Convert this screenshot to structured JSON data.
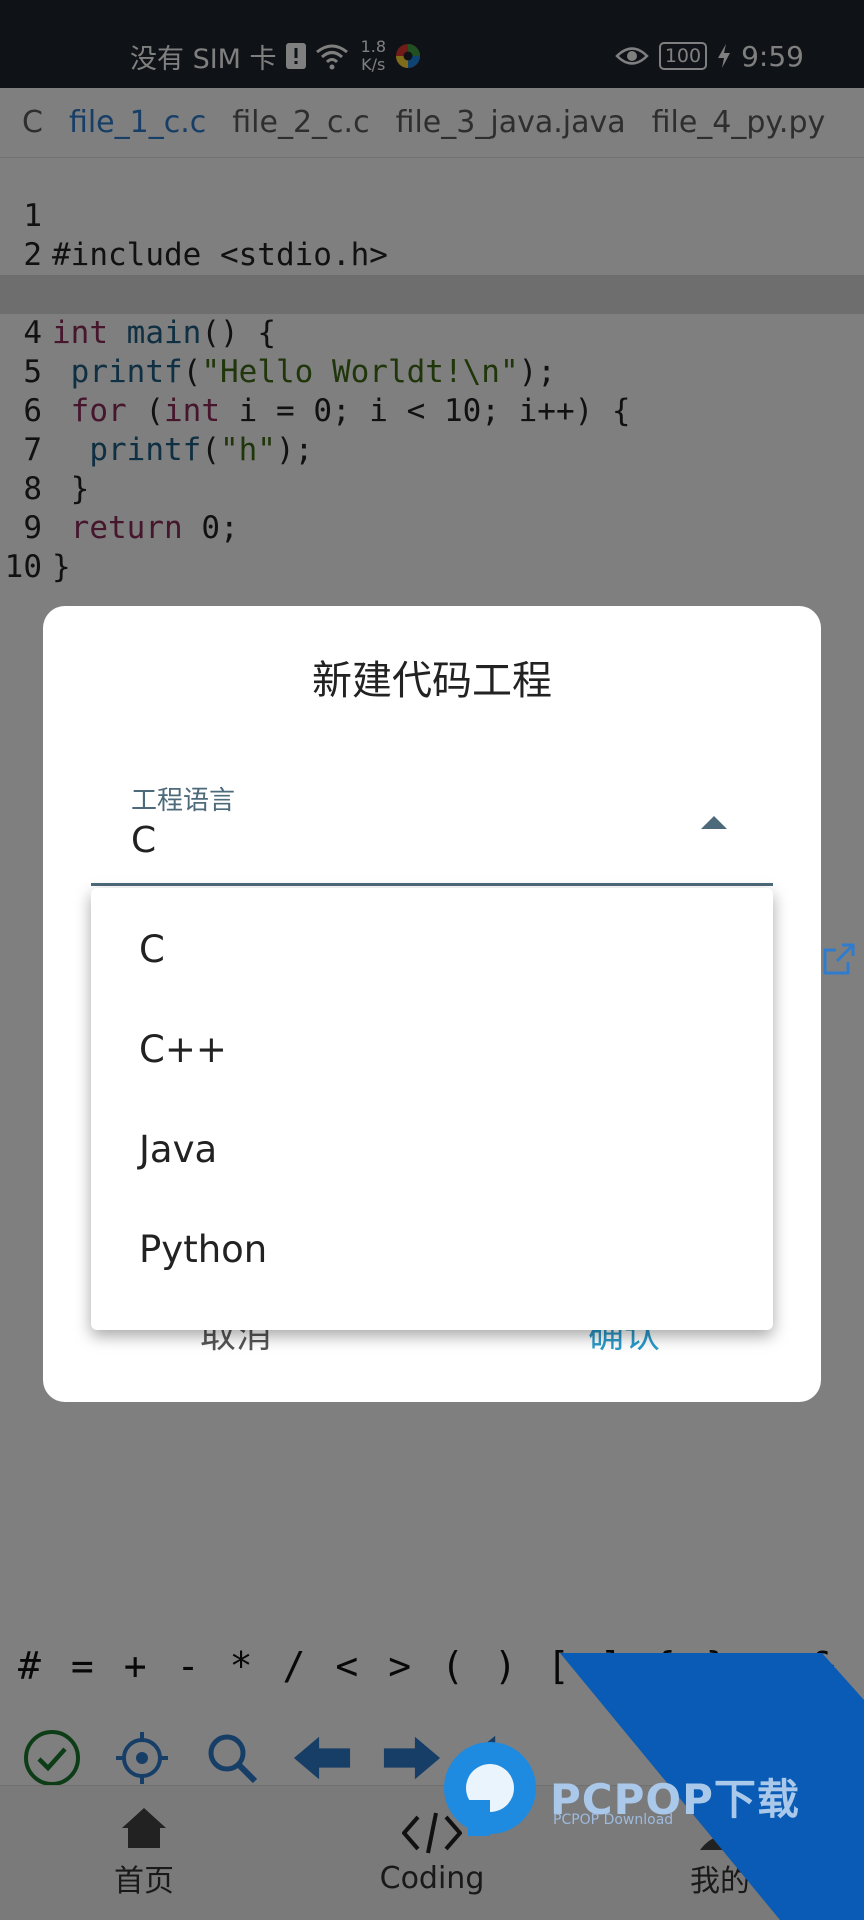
{
  "status_bar": {
    "carrier": "没有 SIM 卡",
    "speed_value": "1.8",
    "speed_unit": "K/s",
    "battery": "100",
    "time": "9:59"
  },
  "tabs": [
    "C",
    "file_1_c.c",
    "file_2_c.c",
    "file_3_java.java",
    "file_4_py.py"
  ],
  "editor": {
    "line_numbers": [
      "1",
      "2",
      "3",
      "4",
      "5",
      "6",
      "7",
      "8",
      "9",
      "10"
    ],
    "code": {
      "l1": "#include <stdio.h>",
      "l3_kw": "int",
      "l3_fn": "main",
      "l3_rest": "() {",
      "l4_fn": "printf",
      "l4_open": "(",
      "l4_str": "\"Hello Worldt!\\n\"",
      "l4_close": ");",
      "l5_kw": "for",
      "l5_a": " (",
      "l5_kw2": "int",
      "l5_rest": " i = 0; i < 10; i++) {",
      "l6_fn": "printf",
      "l6_open": "(",
      "l6_str": "\"h\"",
      "l6_close": ");",
      "l7": "}",
      "l8_kw": "return",
      "l8_rest": " 0;",
      "l9": "}"
    }
  },
  "symbols": [
    "#",
    "=",
    "+",
    "-",
    "*",
    "/",
    "<",
    ">",
    "(",
    ")",
    "[",
    "]",
    "{",
    "}",
    ",",
    "&"
  ],
  "bottom_nav": {
    "home": "首页",
    "coding": "Coding",
    "mine": "我的"
  },
  "dialog": {
    "title": "新建代码工程",
    "field_label": "工程语言",
    "field_value": "C",
    "cancel": "取消",
    "confirm": "确认",
    "options": [
      "C",
      "C++",
      "Java",
      "Python"
    ]
  },
  "watermark": {
    "brand": "PCPOP下载",
    "sub": "PCPOP Download"
  },
  "colors": {
    "status_bar": "#1f252d",
    "active_tab": "#2f7ccf",
    "keyword": "#8a2c59",
    "function": "#1f5e85",
    "string": "#3f6b14",
    "confirm": "#2a99c9",
    "field_accent": "#4d6a7a",
    "watermark_blue": "#0a5bb5"
  }
}
